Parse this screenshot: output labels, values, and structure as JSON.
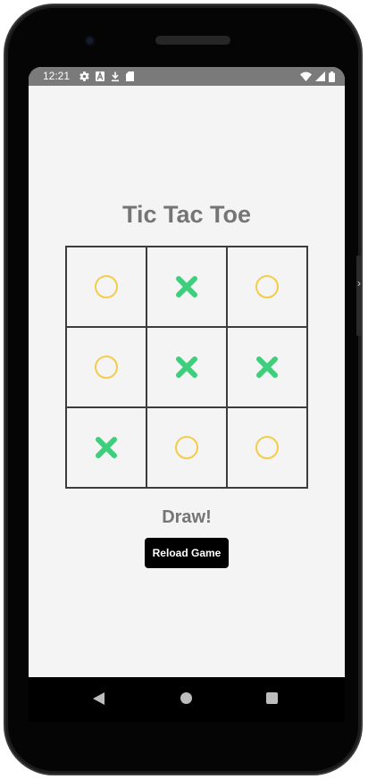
{
  "status_bar": {
    "time": "12:21",
    "left_icons": [
      "gear-icon",
      "a-icon",
      "download-icon",
      "sd-card-icon"
    ],
    "right_icons": [
      "wifi-icon",
      "signal-icon",
      "battery-icon"
    ]
  },
  "game": {
    "title": "Tic Tac Toe",
    "board": [
      [
        "O",
        "X",
        "O"
      ],
      [
        "O",
        "X",
        "X"
      ],
      [
        "X",
        "O",
        "O"
      ]
    ],
    "result": "Draw!",
    "reload_label": "Reload Game"
  },
  "colors": {
    "o_mark": "#f3cd4a",
    "x_mark": "#3ecf7c",
    "screen_background": "#f4f4f4",
    "title_text": "#757575",
    "button_background": "#000000",
    "status_bar": "#7a7a7a"
  },
  "nav_bar": {
    "icons": [
      "back-icon",
      "home-icon",
      "recents-icon"
    ]
  }
}
